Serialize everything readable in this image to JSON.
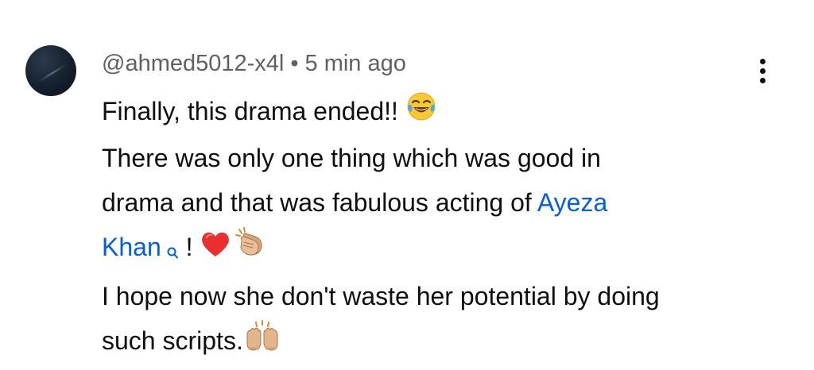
{
  "comment": {
    "author": "@ahmed5012-x4l",
    "separator": "•",
    "timestamp": "5 min ago",
    "lines": {
      "l1": "Finally, this drama ended!! ",
      "l2": "There was only one thing which was good in",
      "l3_prefix": "drama and that was fabulous acting of ",
      "mention_part1": "Ayeza",
      "mention_part2": "Khan",
      "after_mention": " ! ",
      "l5": "I hope now she don't waste her potential by doing",
      "l6": "such scripts."
    },
    "icons": {
      "avatar": "user-avatar",
      "menu": "more-vert-icon",
      "emoji1": "face-with-tears-of-joy",
      "emoji2": "red-heart",
      "emoji3": "clapping-hands",
      "emoji4": "raising-hands",
      "mention_search": "search-icon"
    },
    "colors": {
      "mention": "#065fd4",
      "meta": "#606060",
      "text": "#0f0f0f"
    }
  }
}
